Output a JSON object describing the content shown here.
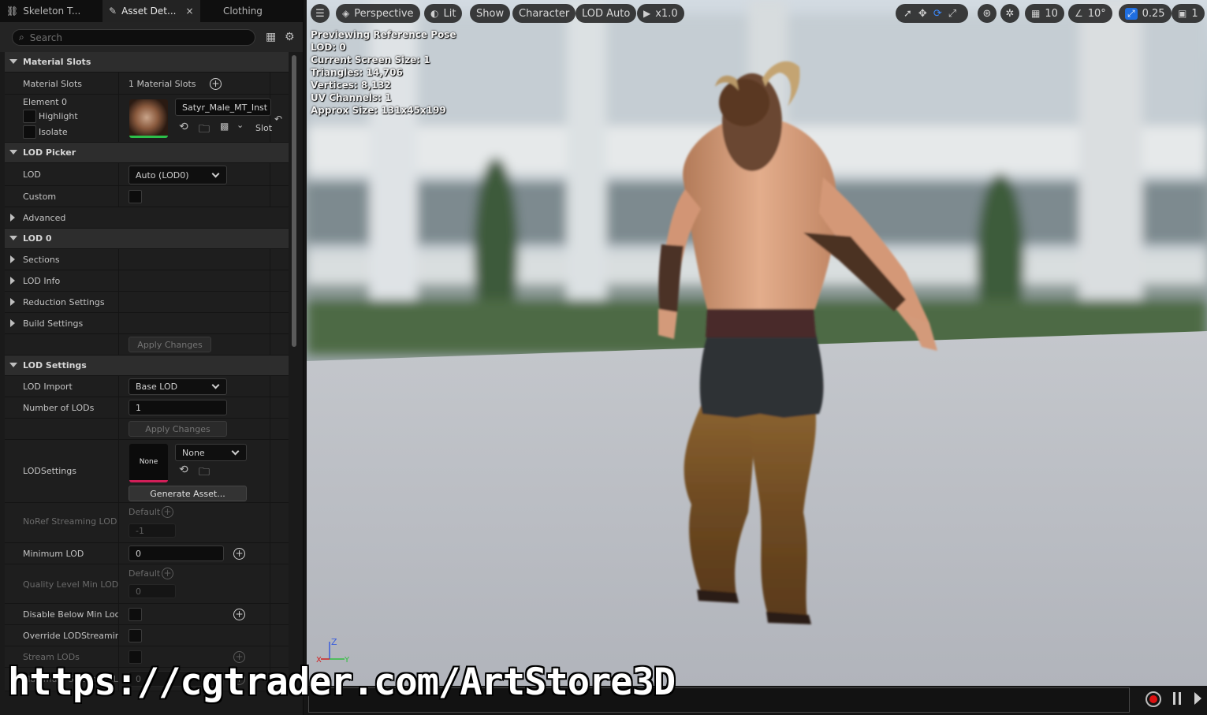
{
  "tabs": [
    {
      "label": "Skeleton T...",
      "icon": "skeleton-tree-icon"
    },
    {
      "label": "Asset Det...",
      "icon": "asset-details-icon",
      "close": "×"
    },
    {
      "label": "Clothing"
    }
  ],
  "search": {
    "placeholder": "Search"
  },
  "material_slots": {
    "header": "Material Slots",
    "label": "Material Slots",
    "count": "1 Material Slots",
    "element": "Element 0",
    "highlight": "Highlight",
    "isolate": "Isolate",
    "material_name": "Satyr_Male_MT_Inst",
    "slot_label": "Slot"
  },
  "lod_picker": {
    "header": "LOD Picker",
    "lod_label": "LOD",
    "lod_value": "Auto (LOD0)",
    "custom_label": "Custom",
    "advanced_label": "Advanced"
  },
  "lod0": {
    "header": "LOD 0",
    "sections": "Sections",
    "lod_info": "LOD Info",
    "reduction": "Reduction Settings",
    "build": "Build Settings",
    "apply": "Apply Changes"
  },
  "lod_settings": {
    "header": "LOD Settings",
    "lod_import_label": "LOD Import",
    "lod_import_value": "Base LOD",
    "num_lods_label": "Number of LODs",
    "num_lods_value": "1",
    "apply": "Apply Changes",
    "lodsettings_label": "LODSettings",
    "lodsettings_thumb": "None",
    "lodsettings_value": "None",
    "generate": "Generate Asset...",
    "noref_label": "NoRef Streaming LOD B",
    "noref_default": "Default",
    "noref_value": "-1",
    "min_lod_label": "Minimum LOD",
    "min_lod_value": "0",
    "quality_label": "Quality Level Min LOD",
    "quality_default": "Default",
    "quality_value": "0",
    "disable_below_label": "Disable Below Min Lod...",
    "override_label": "Override LODStreamin...",
    "stream_lods_label": "Stream LODs",
    "max_streamed_label": "Maximum Streamed L...",
    "max_streamed_value": "0"
  },
  "viewport": {
    "perspective": "Perspective",
    "lit": "Lit",
    "show": "Show",
    "character": "Character",
    "lod_auto": "LOD Auto",
    "play_rate": "x1.0",
    "grid_size": "10",
    "angle_snap": "10°",
    "scale_snap": "0.25",
    "camera_speed": "1",
    "accent_color": "#1f6ee0"
  },
  "stats": [
    "Previewing Reference Pose",
    "LOD: 0",
    "Current Screen Size: 1",
    "Triangles: 14,706",
    "Vertices: 8,132",
    "UV Channels: 1",
    "Approx Size: 131x45x199"
  ],
  "axis": {
    "z": "Z",
    "y": "Y",
    "x": "X"
  },
  "watermark": "https://cgtrader.com/ArtStore3D"
}
